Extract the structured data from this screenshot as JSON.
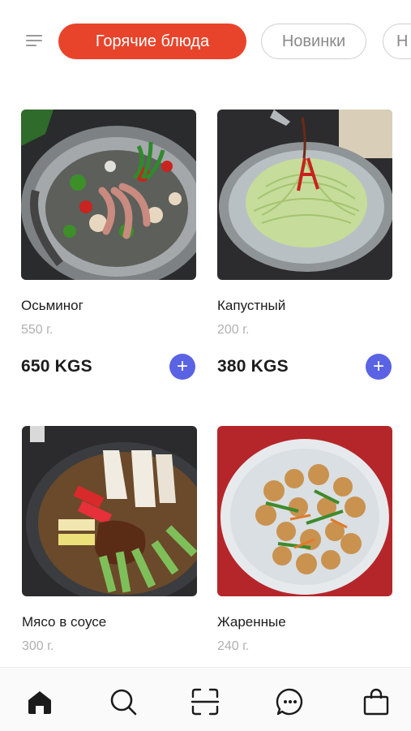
{
  "categories": {
    "menu_icon": "menu-icon",
    "tabs": [
      {
        "label": "Горячие блюда",
        "active": true
      },
      {
        "label": "Новинки",
        "active": false
      },
      {
        "label": "Н",
        "active": false
      }
    ]
  },
  "products": [
    {
      "name": "Осьминог",
      "weight": "550 г.",
      "price": "650 KGS",
      "image": "octopus-stir-fry-photo"
    },
    {
      "name": "Капустный",
      "weight": "200 г.",
      "price": "380 KGS",
      "image": "cabbage-salad-photo"
    },
    {
      "name": "Мясо в соусе",
      "weight": "300 г.",
      "image": "meat-in-sauce-photo"
    },
    {
      "name": "Жаренные",
      "weight": "240 г.",
      "image": "fried-dish-photo"
    }
  ],
  "add_button_symbol": "+",
  "bottom_nav": {
    "items": [
      {
        "icon": "home-icon",
        "active": true
      },
      {
        "icon": "search-icon",
        "active": false
      },
      {
        "icon": "scan-icon",
        "active": false
      },
      {
        "icon": "chat-icon",
        "active": false
      },
      {
        "icon": "bag-icon",
        "active": false
      }
    ]
  },
  "colors": {
    "accent": "#e8442b",
    "add_button": "#5a63e3",
    "muted_text": "#b0b0b0"
  }
}
